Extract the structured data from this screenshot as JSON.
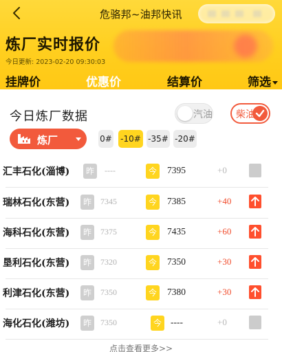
{
  "header": {
    "app_title": "危骆邦~油邦快讯",
    "page_title": "炼厂实时报价",
    "update_label": "今日更新",
    "update_time": "2023-02-20 09:30:03"
  },
  "tabs": [
    {
      "label": "挂牌价",
      "active": false
    },
    {
      "label": "优惠价",
      "active": true
    },
    {
      "label": "结算价",
      "active": false
    },
    {
      "label": "筛选",
      "active": false
    }
  ],
  "section_title": "今日炼厂数据",
  "fuel": {
    "gasoline": {
      "label": "汽油",
      "on": false
    },
    "diesel": {
      "label": "柴油",
      "on": true
    }
  },
  "factory_filter": {
    "label": "炼厂"
  },
  "grades": [
    {
      "label": "0#",
      "active": false
    },
    {
      "label": "-10#",
      "active": true
    },
    {
      "label": "-35#",
      "active": false
    },
    {
      "label": "-20#",
      "active": false
    }
  ],
  "tags": {
    "yesterday": "昨",
    "today": "今"
  },
  "rows": [
    {
      "name": "汇丰石化(淄博)",
      "yesterday": "----",
      "today": "7395",
      "change": "+0",
      "trend": "flat"
    },
    {
      "name": "瑞林石化(东营)",
      "yesterday": "7345",
      "today": "7385",
      "change": "+40",
      "trend": "up"
    },
    {
      "name": "海科石化(东营)",
      "yesterday": "7375",
      "today": "7435",
      "change": "+60",
      "trend": "up"
    },
    {
      "name": "垦利石化(东营)",
      "yesterday": "7320",
      "today": "7350",
      "change": "+30",
      "trend": "up"
    },
    {
      "name": "利津石化(东营)",
      "yesterday": "7350",
      "today": "7380",
      "change": "+30",
      "trend": "up"
    },
    {
      "name": "海化石化(潍坊)",
      "yesterday": "7350",
      "today": "----",
      "change": "+0",
      "trend": "flat"
    }
  ],
  "more_label": "点击查看更多>>",
  "colors": {
    "brand_yellow": "#ffcf1f",
    "accent_red": "#f25a3c",
    "up_red": "#ff4f2e",
    "muted_gray": "#cccccc"
  }
}
